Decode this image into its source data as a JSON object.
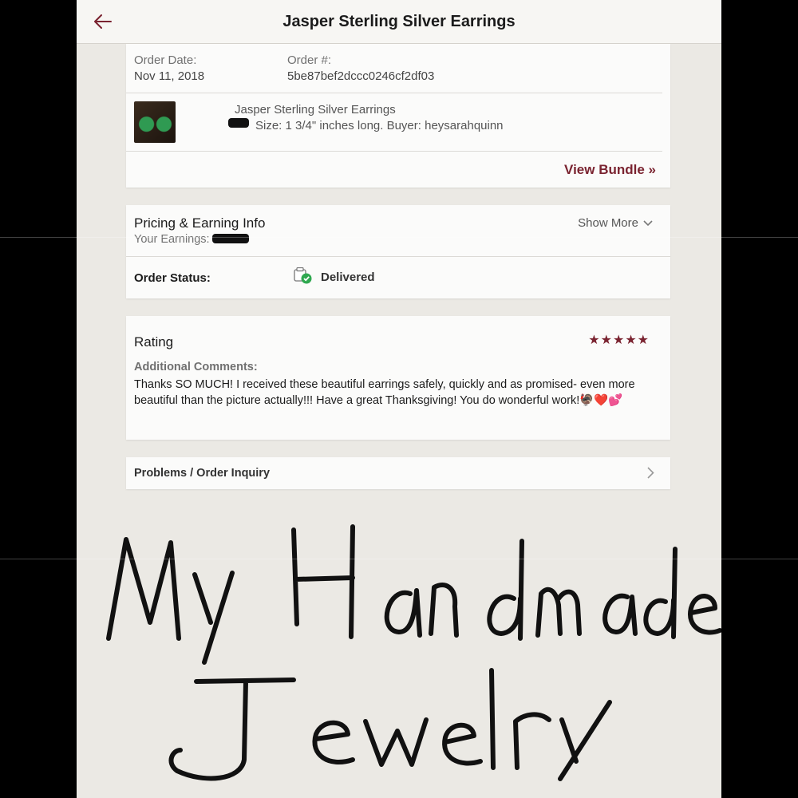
{
  "header": {
    "title": "Jasper Sterling Silver Earrings",
    "back_icon": "back-arrow-icon"
  },
  "order": {
    "date_label": "Order Date:",
    "date_value": "Nov 11, 2018",
    "number_label": "Order #:",
    "number_value": "5be87bef2dccc0246cf2df03",
    "item_title": "Jasper Sterling Silver Earrings",
    "item_details": "Size: 1 3/4\" inches long.  Buyer: heysarahquinn",
    "view_bundle": "View Bundle »"
  },
  "pricing": {
    "title": "Pricing & Earning Info",
    "earnings_label": "Your Earnings:",
    "show_more": "Show More"
  },
  "status": {
    "label": "Order Status:",
    "value": "Delivered"
  },
  "rating": {
    "title": "Rating",
    "stars": 5,
    "comments_label": "Additional Comments:",
    "comment": "Thanks SO MUCH! I received these beautiful earrings safely, quickly and as promised- even more beautiful than the picture actually!!! Have a great Thanksgiving! You do wonderful work!🦃❤️💕"
  },
  "inquiry": {
    "label": "Problems / Order Inquiry"
  },
  "overlay": {
    "handwritten_text": "My Handmade Jewelry"
  },
  "colors": {
    "accent": "#7a2330",
    "background": "#ebe9e4",
    "card": "#fbfbfa"
  }
}
